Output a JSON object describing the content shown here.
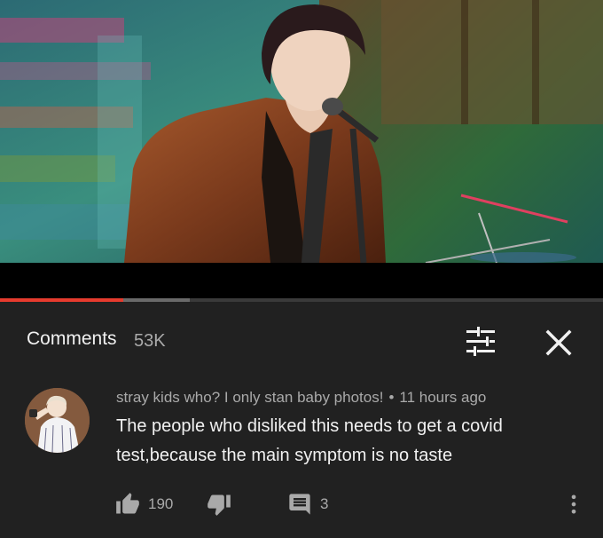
{
  "video": {
    "progress_played": 0.205,
    "progress_buffered": 0.315,
    "colors": {
      "played": "#e63b2e",
      "buffered": "#6a6a6a",
      "track": "#3a3a3a"
    }
  },
  "comments_panel": {
    "title": "Comments",
    "count": "53K",
    "filter_icon": "sort-filter-icon",
    "close_icon": "close-icon"
  },
  "comment": {
    "author": "stray kids who? I only stan baby photos!",
    "separator": "•",
    "time": "11 hours ago",
    "text": "The people who disliked this needs to get a covid test,because the main symptom is no taste",
    "likes": "190",
    "replies": "3",
    "icons": [
      "thumbs-up-icon",
      "thumbs-down-icon",
      "reply-icon",
      "more-vertical-icon"
    ]
  }
}
